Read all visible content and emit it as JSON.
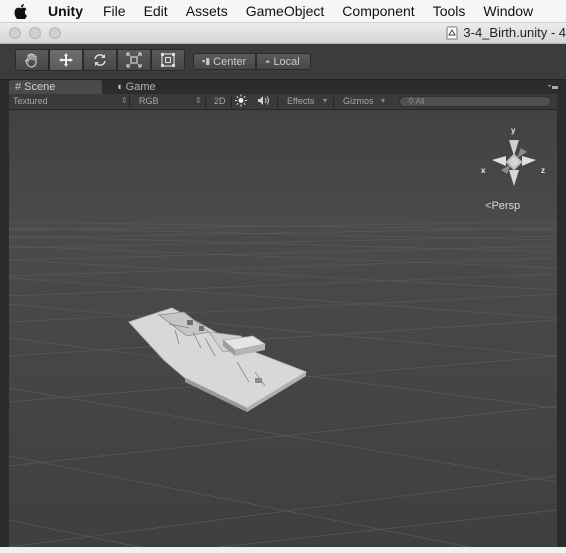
{
  "menubar": {
    "app_name": "Unity",
    "items": [
      "File",
      "Edit",
      "Assets",
      "GameObject",
      "Component",
      "Tools",
      "Window"
    ]
  },
  "window": {
    "title": "3-4_Birth.unity - 4"
  },
  "toolbar": {
    "tools": [
      "hand-tool",
      "move-tool",
      "rotate-tool",
      "scale-tool",
      "rect-tool"
    ],
    "active_tool": "move-tool",
    "pivot_center_label": "Center",
    "pivot_local_label": "Local"
  },
  "tabs": {
    "scene_label": "Scene",
    "game_label": "Game"
  },
  "scene_controls": {
    "draw_mode": "Textured",
    "render_mode": "RGB",
    "mode_2d_label": "2D",
    "effects_label": "Effects",
    "gizmos_label": "Gizmos",
    "search_placeholder": "All"
  },
  "gizmo": {
    "y_label": "y",
    "x_label": "x",
    "z_label": "z",
    "projection_label": "Persp"
  },
  "colors": {
    "viewport_bg": "#464646",
    "toolbar_bg": "#3c3c3c",
    "grid_line": "#5a5a5a",
    "model_top": "#d8d8d8"
  }
}
